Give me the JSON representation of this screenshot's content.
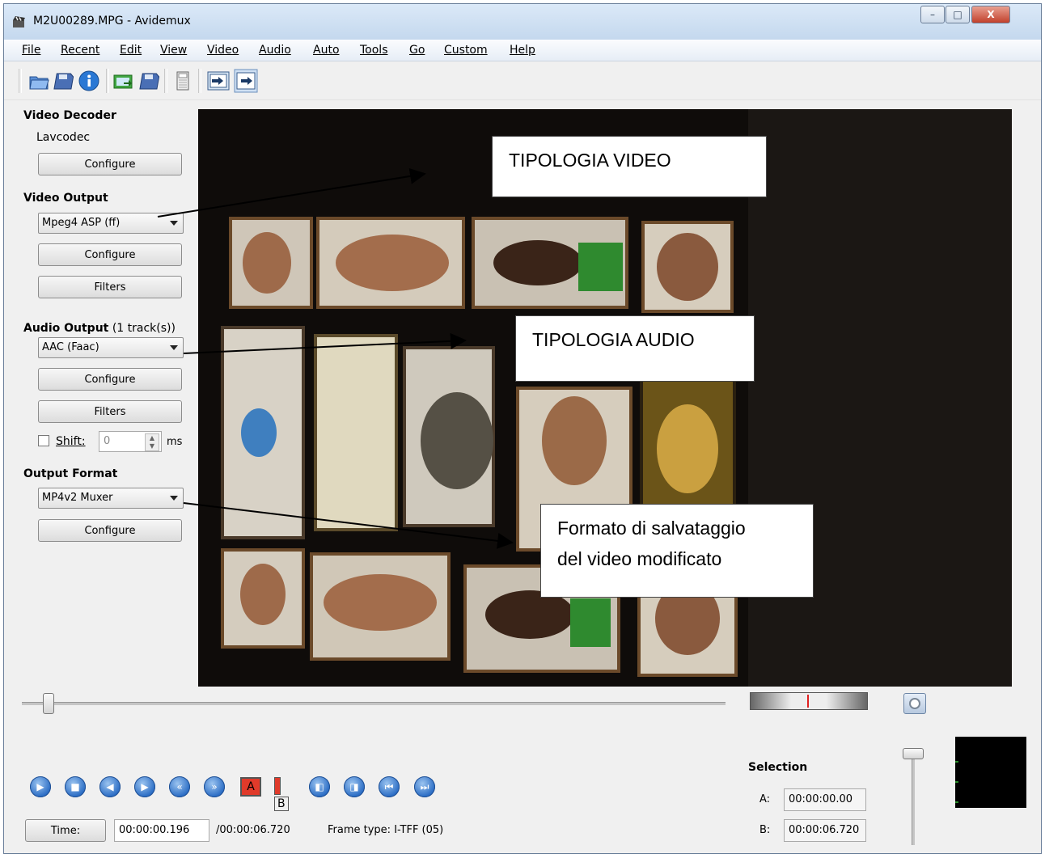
{
  "window": {
    "title": "M2U00289.MPG - Avidemux",
    "minimize_label": "–",
    "maximize_label": "□",
    "close_label": "X"
  },
  "menu": [
    "File",
    "Recent",
    "Edit",
    "View",
    "Video",
    "Audio",
    "Auto",
    "Tools",
    "Go",
    "Custom",
    "Help"
  ],
  "toolbar_icons": [
    "open-file-icon",
    "save-icon",
    "info-icon",
    "open-folder-icon",
    "save-video-icon",
    "calculator-icon",
    "input-preview-icon",
    "output-preview-icon"
  ],
  "video_decoder": {
    "heading": "Video Decoder",
    "codec": "Lavcodec",
    "configure": "Configure"
  },
  "video_output": {
    "heading": "Video Output",
    "selected": "Mpeg4 ASP (ff)",
    "configure": "Configure",
    "filters": "Filters"
  },
  "audio_output": {
    "heading": "Audio Output",
    "tracks": "(1 track(s))",
    "selected": "AAC (Faac)",
    "configure": "Configure",
    "filters": "Filters",
    "shift_label": "Shift:",
    "shift_value": "0",
    "shift_unit": "ms"
  },
  "output_format": {
    "heading": "Output Format",
    "selected": "MP4v2 Muxer",
    "configure": "Configure"
  },
  "annotations": {
    "video_type": "TIPOLOGIA VIDEO",
    "audio_type": "TIPOLOGIA AUDIO",
    "save_format_line1": "Formato di salvataggio",
    "save_format_line2": "del video modificato"
  },
  "playback": {
    "time_button": "Time:",
    "current_time": "00:00:00.196",
    "total_time": "/00:00:06.720",
    "frame_type": "Frame type:  I-TFF (05)",
    "mark_a": "A",
    "mark_b": "B",
    "slider_position": 0.03
  },
  "selection": {
    "heading": "Selection",
    "a_label": "A:",
    "a_value": "00:00:00.00",
    "b_label": "B:",
    "b_value": "00:00:06.720"
  },
  "colors": {
    "accent_blue": "#2a6cc4",
    "annotation_border": "#444444",
    "marker_red": "#e02020"
  }
}
